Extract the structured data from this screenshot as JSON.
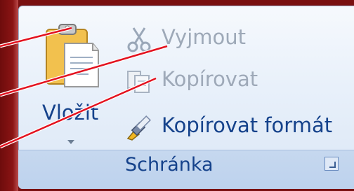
{
  "ribbon_group": {
    "name": "Schránka",
    "paste_label": "Vložit",
    "cut_label": "Vyjmout",
    "copy_label": "Kopírovat",
    "format_painter_label": "Kopírovat formát"
  },
  "states": {
    "cut": "disabled",
    "copy": "disabled",
    "format_painter": "enabled"
  },
  "colors": {
    "background_dark_red": "#7a1010",
    "ribbon_text": "#15428b",
    "disabled_text": "#9ea9b8",
    "annotation_line": "#e3121f"
  },
  "icons": [
    "clipboard-icon",
    "scissors-icon",
    "copy-pages-icon",
    "paintbrush-icon",
    "dialog-launcher-icon",
    "dropdown-arrow-icon"
  ]
}
